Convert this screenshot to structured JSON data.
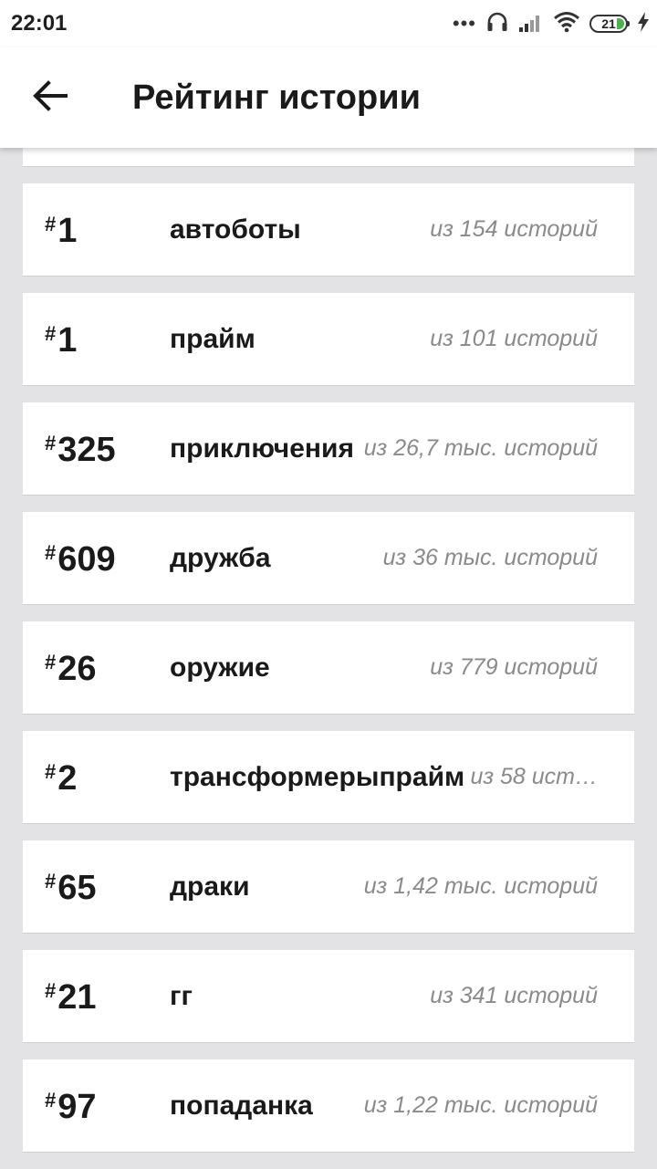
{
  "status_bar": {
    "time": "22:01",
    "dots": "•••",
    "battery_level": "21",
    "battery_color": "#4caf50"
  },
  "header": {
    "title": "Рейтинг истории"
  },
  "rankings": [
    {
      "hash": "#",
      "rank": "1",
      "tag": "автоботы",
      "total": "из 154 историй"
    },
    {
      "hash": "#",
      "rank": "1",
      "tag": "прайм",
      "total": "из 101 историй"
    },
    {
      "hash": "#",
      "rank": "325",
      "tag": "приключения",
      "total": "из 26,7 тыс. историй"
    },
    {
      "hash": "#",
      "rank": "609",
      "tag": "дружба",
      "total": "из 36 тыс. историй"
    },
    {
      "hash": "#",
      "rank": "26",
      "tag": "оружие",
      "total": "из 779 историй"
    },
    {
      "hash": "#",
      "rank": "2",
      "tag": "трансформерыпрайм",
      "total": "из 58 ист…"
    },
    {
      "hash": "#",
      "rank": "65",
      "tag": "драки",
      "total": "из 1,42 тыс. историй"
    },
    {
      "hash": "#",
      "rank": "21",
      "tag": "гг",
      "total": "из 341 историй"
    },
    {
      "hash": "#",
      "rank": "97",
      "tag": "попаданка",
      "total": "из 1,22 тыс. историй"
    }
  ]
}
